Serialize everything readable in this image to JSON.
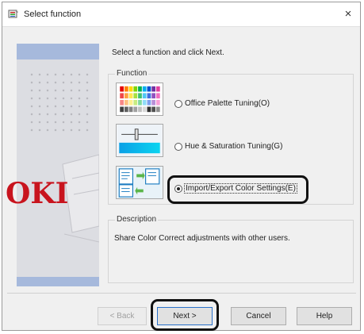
{
  "window": {
    "title": "Select function",
    "close_glyph": "×"
  },
  "banner": {
    "logo_text": "OKI"
  },
  "main": {
    "instruction": "Select a function and click Next.",
    "function_group_label": "Function",
    "functions": [
      {
        "label": "Office Palette Tuning(O)",
        "selected": false,
        "icon": "color-palette-icon"
      },
      {
        "label": "Hue & Saturation Tuning(G)",
        "selected": false,
        "icon": "hue-saturation-slider-icon"
      },
      {
        "label": "Import/Export Color Settings(E)",
        "selected": true,
        "icon": "import-export-icon"
      }
    ],
    "description_label": "Description",
    "description_text": "Share Color Correct adjustments with other users."
  },
  "buttons": {
    "back": "< Back",
    "next": "Next >",
    "cancel": "Cancel",
    "help": "Help"
  },
  "colors": {
    "oki_red": "#c8141e",
    "banner_blue": "#a6b9dc",
    "highlight_ring": "#111111"
  }
}
